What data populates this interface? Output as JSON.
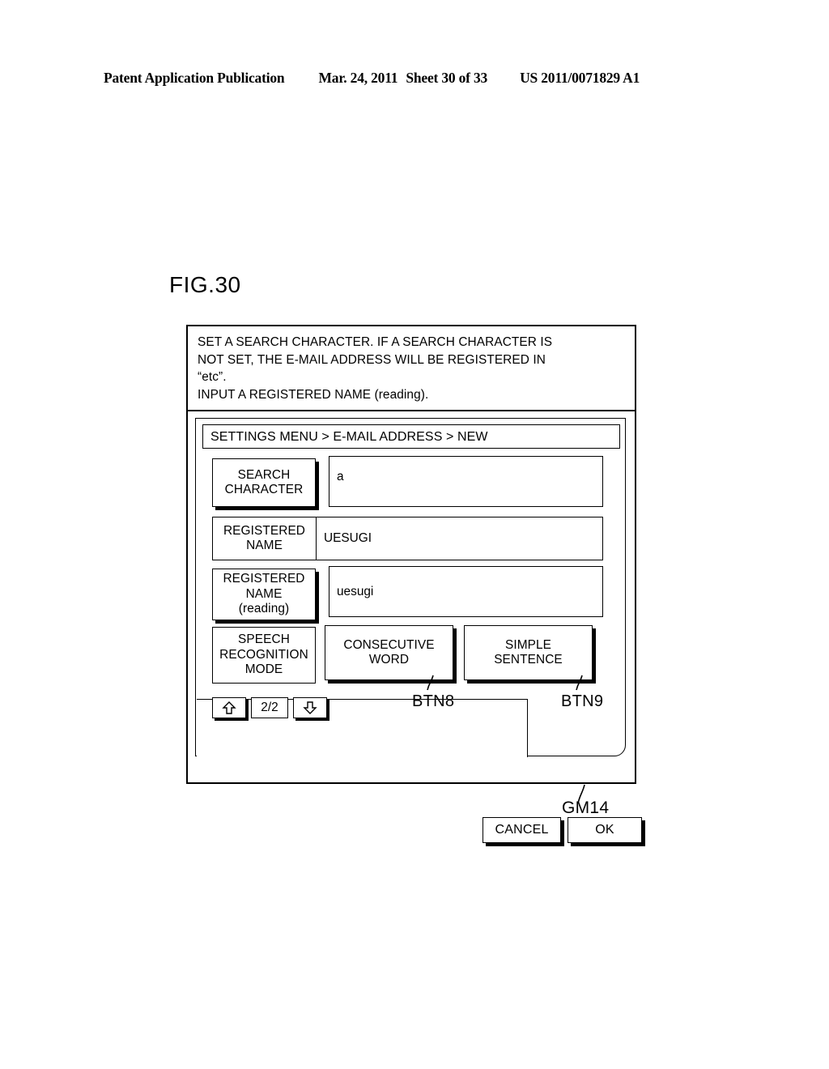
{
  "page_header": {
    "publication": "Patent Application Publication",
    "date": "Mar. 24, 2011",
    "sheet": "Sheet 30 of 33",
    "number": "US 2011/0071829 A1"
  },
  "figure": {
    "label": "FIG.30",
    "callout_screen": "GM14"
  },
  "dialog": {
    "message_lines": [
      "SET A SEARCH CHARACTER.  IF A SEARCH CHARACTER IS",
      "NOT SET, THE E-MAIL ADDRESS WILL BE REGISTERED IN",
      "“etc”.",
      "INPUT A REGISTERED NAME (reading)."
    ],
    "breadcrumb": "SETTINGS MENU > E-MAIL ADDRESS > NEW",
    "rows": [
      {
        "label": "SEARCH\nCHARACTER",
        "label_line1": "SEARCH",
        "label_line2": "CHARACTER",
        "value": "a"
      },
      {
        "label": "REGISTERED\nNAME",
        "label_line1": "REGISTERED",
        "label_line2": "NAME",
        "value": "UESUGI"
      },
      {
        "label": "REGISTERED\nNAME\n(reading)",
        "label_line1": "REGISTERED",
        "label_line2": "NAME",
        "label_line3": "(reading)",
        "value": "uesugi"
      }
    ],
    "speech_mode": {
      "label_line1": "SPEECH",
      "label_line2": "RECOGNITION",
      "label_line3": "MODE",
      "options": [
        {
          "line1": "CONSECUTIVE",
          "line2": "WORD",
          "callout": "BTN8"
        },
        {
          "line1": "SIMPLE",
          "line2": "SENTENCE",
          "callout": "BTN9"
        }
      ]
    },
    "pager": {
      "up_icon": "up-arrow-icon",
      "count": "2/2",
      "down_icon": "down-arrow-icon"
    },
    "actions": {
      "cancel": "CANCEL",
      "ok": "OK"
    }
  },
  "colors": {
    "ink": "#000000",
    "paper": "#ffffff"
  }
}
